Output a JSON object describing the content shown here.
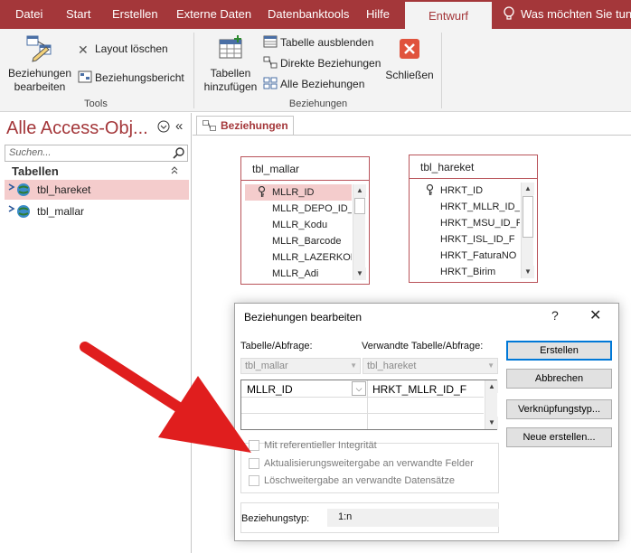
{
  "ribbon_tabs": [
    "Datei",
    "Start",
    "Erstellen",
    "Externe Daten",
    "Datenbanktools",
    "Hilfe",
    "Entwurf"
  ],
  "active_tab": "Entwurf",
  "tell_me": "Was möchten Sie tun",
  "colors": {
    "accent": "#a4373a",
    "selection": "#f4cccc",
    "primary_button_border": "#0078d7",
    "arrow": "#e01e1e"
  },
  "ribbon": {
    "tools": {
      "edit_label": "Beziehungen\nbearbeiten",
      "clear_layout": "Layout löschen",
      "report": "Beziehungsbericht",
      "group_label": "Tools"
    },
    "relationships": {
      "add_tables": "Tabellen\nhinzufügen",
      "hide_table": "Tabelle ausblenden",
      "direct": "Direkte Beziehungen",
      "all": "Alle Beziehungen",
      "close": "Schließen",
      "group_label": "Beziehungen"
    }
  },
  "nav": {
    "title": "Alle Access-Obj...",
    "search_placeholder": "Suchen...",
    "section": "Tabellen",
    "items": [
      {
        "label": "tbl_hareket",
        "selected": true
      },
      {
        "label": "tbl_mallar",
        "selected": false
      }
    ]
  },
  "doc_tab": "Beziehungen",
  "tables": [
    {
      "name": "tbl_mallar",
      "fields": [
        "MLLR_ID",
        "MLLR_DEPO_ID_F",
        "MLLR_Kodu",
        "MLLR_Barcode",
        "MLLR_LAZERKOD",
        "MLLR_Adi"
      ]
    },
    {
      "name": "tbl_hareket",
      "fields": [
        "HRKT_ID",
        "HRKT_MLLR_ID_F",
        "HRKT_MSU_ID_F",
        "HRKT_ISL_ID_F",
        "HRKT_FaturaNO",
        "HRKT_Birim"
      ]
    }
  ],
  "dialog": {
    "title": "Beziehungen bearbeiten",
    "help": "?",
    "close": "✕",
    "table_label": "Tabelle/Abfrage:",
    "related_label": "Verwandte Tabelle/Abfrage:",
    "table_value": "tbl_mallar",
    "related_value": "tbl_hareket",
    "field_left": "MLLR_ID",
    "field_right": "HRKT_MLLR_ID_F",
    "buttons": {
      "create": "Erstellen",
      "cancel": "Abbrechen",
      "join_type": "Verknüpfungstyp...",
      "create_new": "Neue erstellen..."
    },
    "checkboxes": [
      "Mit referentieller Integrität",
      "Aktualisierungsweitergabe an verwandte Felder",
      "Löschweitergabe an verwandte Datensätze"
    ],
    "relationship_type_label": "Beziehungstyp:",
    "relationship_type": "1:n"
  }
}
